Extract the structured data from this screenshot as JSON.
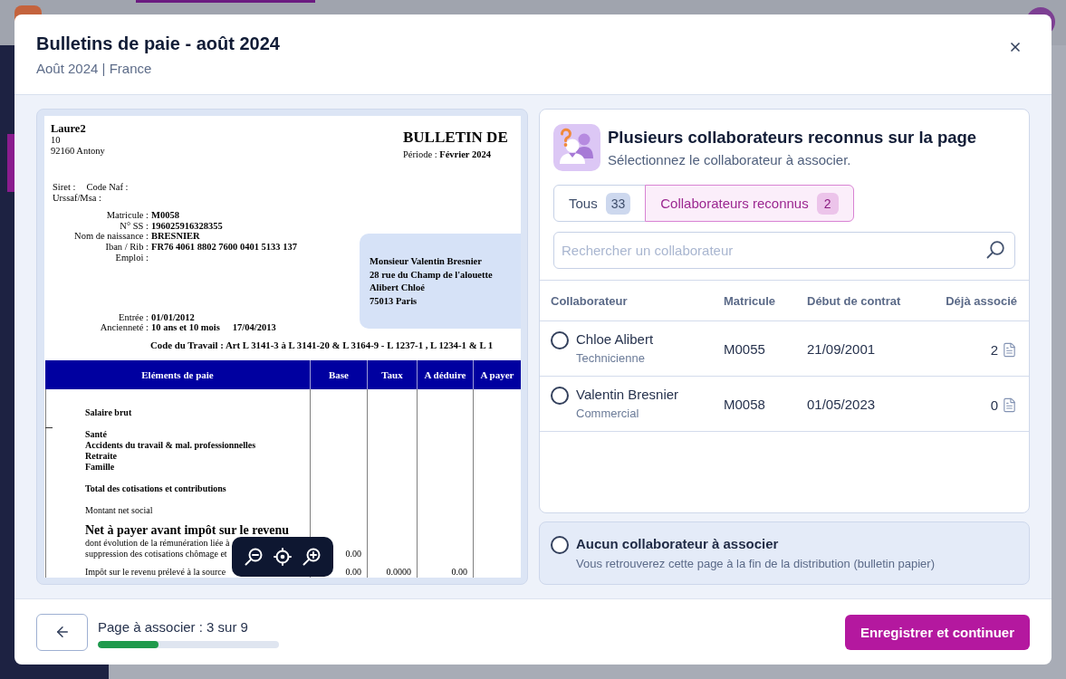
{
  "window": {
    "title": "Bulletins de paie - août 2024",
    "subtitle": "Août 2024 | France"
  },
  "document": {
    "employer_name": "Laure2",
    "employer_address": [
      "10",
      "92160 Antony"
    ],
    "title": "BULLETIN DE",
    "period": "Période : **Février 2024**",
    "registration": [
      [
        "Siret :",
        "Code Naf :"
      ],
      [
        "Urssaf/Msa :"
      ]
    ],
    "employee_fields": [
      {
        "label": "Matricule :",
        "value": "M0058"
      },
      {
        "label": "N° SS :",
        "value": "196025916328355"
      },
      {
        "label": "Nom de naissance :",
        "value": "BRESNIER"
      },
      {
        "label": "Iban / Rib :",
        "value": "FR76 4061 8802 7600 0401 5133 137"
      },
      {
        "label": "Emploi :"
      }
    ],
    "employment_fields": [
      {
        "label": "Entrée :",
        "values": [
          "01/01/2012"
        ]
      },
      {
        "label": "Ancienneté :",
        "values": [
          "10 ans et 10 mois",
          "17/04/2013"
        ]
      }
    ],
    "recipient_address": [
      "Monsieur Valentin Bresnier",
      "28 rue du Champ de l'alouette",
      "Alibert Chloé",
      "75013 Paris"
    ],
    "legal_reference": "Code du Travail : Art L 3141-3 à L 3141-20 & L 3164-9 - L 1237-1 , L 1234-1 & L 1",
    "pay_table": {
      "columns": [
        "Eléments de paie",
        "Base",
        "Taux",
        "A déduire",
        "A payer"
      ],
      "groups": [
        [
          {
            "label": "Salaire brut",
            "kind": "bold"
          }
        ],
        [
          {
            "label": "Santé",
            "kind": "bold"
          },
          {
            "label": "Accidents du travail & mal. professionnelles",
            "kind": "bold"
          },
          {
            "label": "Retraite",
            "kind": "bold"
          },
          {
            "label": "Famille",
            "kind": "bold"
          }
        ],
        [
          {
            "label": "Total des cotisations et contributions",
            "kind": "bold"
          }
        ],
        [
          {
            "label": "Montant net social",
            "kind": "plain"
          }
        ],
        [
          {
            "label": "Net à payer avant impôt sur le revenu",
            "kind": "large"
          },
          {
            "label": "dont évolution de la rémunération liée à",
            "kind": "plain"
          },
          {
            "label": "suppression des cotisations chômage et",
            "kind": "plain",
            "values": [
              "0.00"
            ]
          }
        ],
        [
          {
            "label": "Impôt sur le revenu prélevé à la source",
            "kind": "plain",
            "values": [
              "0.00",
              "0.0000",
              "0.00"
            ]
          }
        ]
      ]
    }
  },
  "match_panel": {
    "title": "Plusieurs collaborateurs reconnus sur la page",
    "subtitle": "Sélectionnez le collaborateur à associer.",
    "tabs": [
      {
        "label": "Tous",
        "count": "33",
        "selected": false
      },
      {
        "label": "Collaborateurs reconnus",
        "count": "2",
        "selected": true
      }
    ],
    "search": {
      "placeholder": "Rechercher un collaborateur"
    },
    "table": {
      "columns": [
        "Collaborateur",
        "Matricule",
        "Début de contrat",
        "Déjà associé"
      ],
      "rows": [
        {
          "name": "Chloe Alibert",
          "role": "Technicienne",
          "matricule": "M0055",
          "start_date": "21/09/2001",
          "associated": "2",
          "selected": false
        },
        {
          "name": "Valentin Bresnier",
          "role": "Commercial",
          "matricule": "M0058",
          "start_date": "01/05/2023",
          "associated": "0",
          "selected": false
        }
      ]
    }
  },
  "no_match_option": {
    "title": "Aucun collaborateur à associer",
    "description": "Vous retrouverez cette page à la fin de la distribution (bulletin papier)",
    "selected": false
  },
  "footer": {
    "progress_label": "Page à associer : 3 sur 9",
    "progress": {
      "level": 0.335
    },
    "primary_button": "Enregistrer et continuer"
  }
}
